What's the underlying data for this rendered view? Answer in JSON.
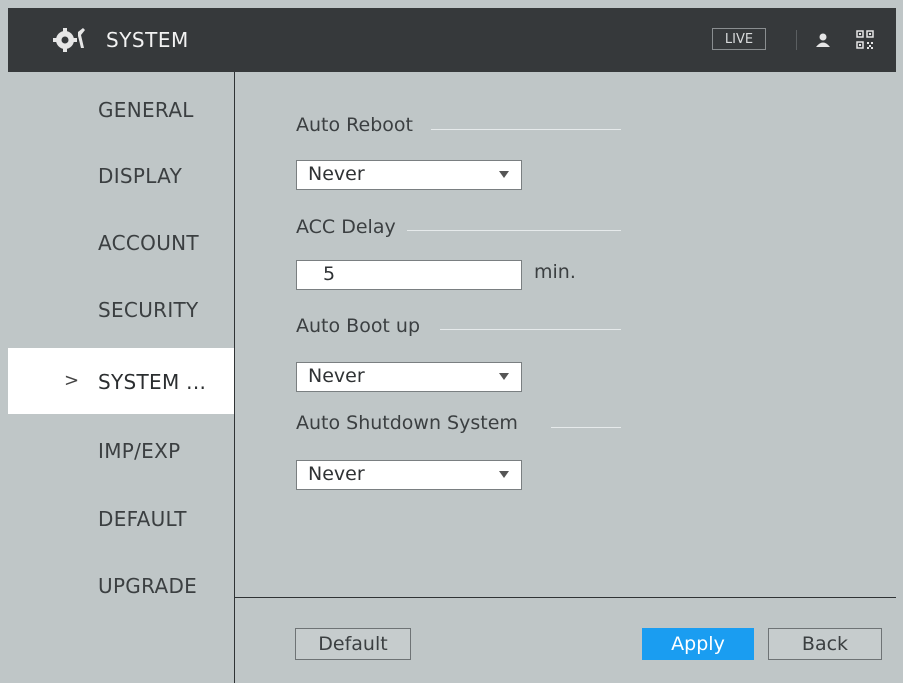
{
  "header": {
    "title": "SYSTEM",
    "live_label": "LIVE",
    "icons": [
      "gear-icon",
      "user-icon",
      "qr-code-icon"
    ]
  },
  "sidebar": {
    "items": [
      {
        "label": "GENERAL",
        "active": false
      },
      {
        "label": "DISPLAY",
        "active": false
      },
      {
        "label": "ACCOUNT",
        "active": false
      },
      {
        "label": "SECURITY",
        "active": false
      },
      {
        "label": "SYSTEM ...",
        "active": true,
        "marker": ">"
      },
      {
        "label": "IMP/EXP",
        "active": false
      },
      {
        "label": "DEFAULT",
        "active": false
      },
      {
        "label": "UPGRADE",
        "active": false
      }
    ]
  },
  "main": {
    "auto_reboot": {
      "title": "Auto Reboot",
      "value": "Never"
    },
    "acc_delay": {
      "title": "ACC Delay",
      "value": "5",
      "unit": "min."
    },
    "auto_boot": {
      "title": "Auto Boot up",
      "value": "Never"
    },
    "auto_shutdown": {
      "title": "Auto Shutdown System",
      "value": "Never"
    }
  },
  "footer": {
    "default_label": "Default",
    "apply_label": "Apply",
    "back_label": "Back"
  },
  "colors": {
    "header_bg": "#36393b",
    "panel_bg": "#bfc6c7",
    "accent": "#1a9df1"
  }
}
